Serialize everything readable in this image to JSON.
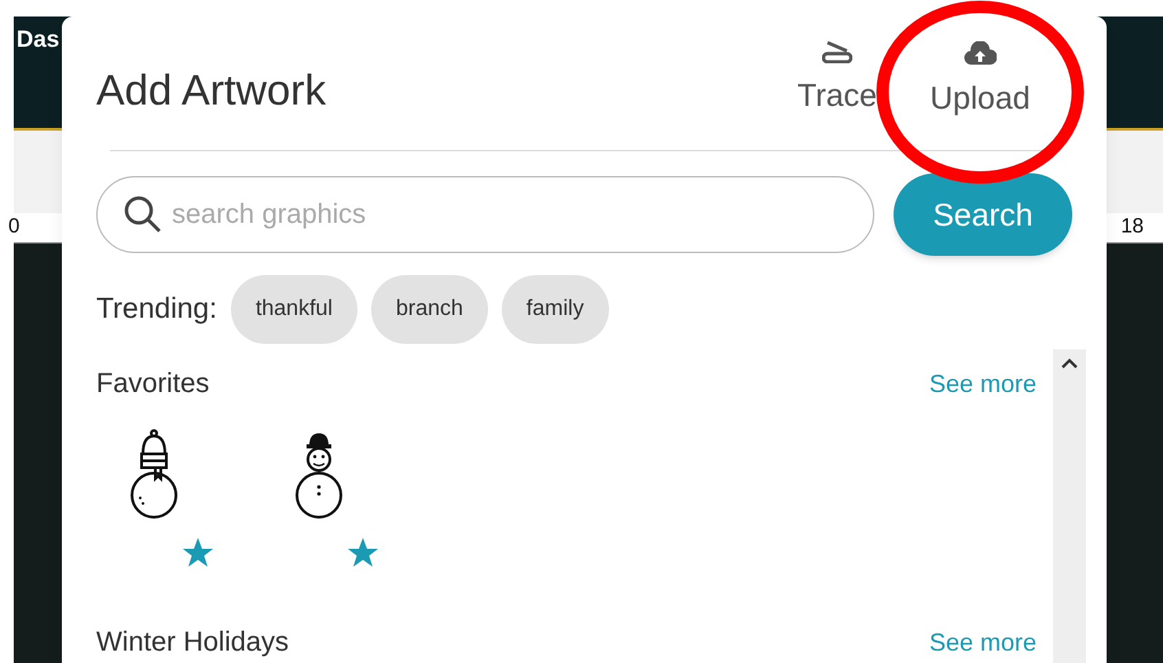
{
  "background": {
    "header_label": "Das",
    "ruler_labels": [
      "0",
      "18"
    ]
  },
  "dialog": {
    "title": "Add Artwork",
    "actions": [
      {
        "kind": "trace",
        "label": "Trace",
        "highlighted": false
      },
      {
        "kind": "upload",
        "label": "Upload",
        "highlighted": true
      }
    ],
    "search": {
      "placeholder": "search graphics",
      "button": "Search"
    },
    "trending": {
      "label": "Trending:",
      "tags": [
        "thankful",
        "branch",
        "family"
      ]
    },
    "sections": [
      {
        "title": "Favorites",
        "link": "See more",
        "items": [
          {
            "kind": "snowman-hat",
            "starred": true
          },
          {
            "kind": "snowman-tophat",
            "starred": true
          }
        ]
      },
      {
        "title": "Winter Holidays",
        "link": "See more"
      }
    ]
  }
}
